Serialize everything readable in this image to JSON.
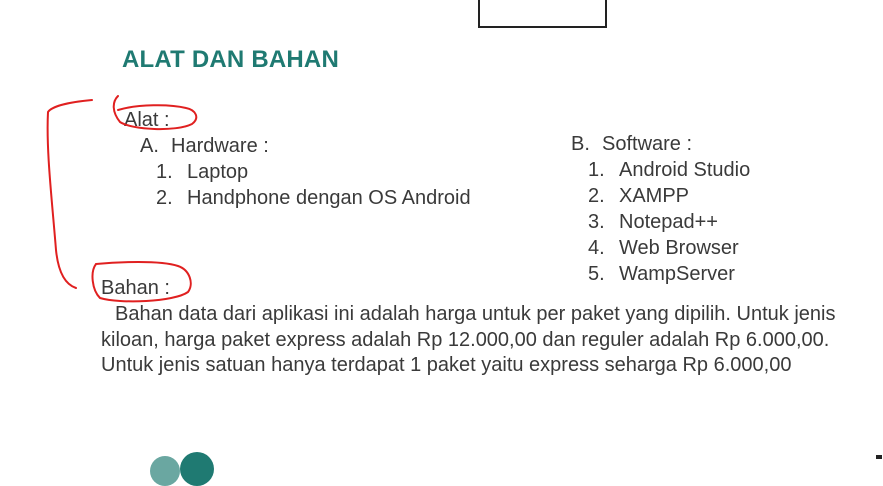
{
  "heading": "ALAT DAN BAHAN",
  "alat": {
    "label": "Alat :",
    "hardware": {
      "marker": "A.",
      "label": "Hardware :",
      "items": [
        {
          "num": "1.",
          "text": "Laptop"
        },
        {
          "num": "2.",
          "text": "Handphone dengan OS Android"
        }
      ]
    },
    "software": {
      "marker": "B.",
      "label": "Software :",
      "items": [
        {
          "num": "1.",
          "text": "Android Studio"
        },
        {
          "num": "2.",
          "text": "XAMPP"
        },
        {
          "num": "3.",
          "text": "Notepad++"
        },
        {
          "num": "4.",
          "text": "Web Browser"
        },
        {
          "num": "5.",
          "text": "WampServer"
        }
      ]
    }
  },
  "bahan": {
    "label": "Bahan :",
    "paragraph": "Bahan data dari aplikasi ini adalah harga untuk per paket yang dipilih. Untuk jenis kiloan, harga paket express adalah Rp 12.000,00 dan reguler adalah Rp 6.000,00. Untuk jenis satuan hanya terdapat 1 paket yaitu express seharga Rp 6.000,00"
  },
  "colors": {
    "heading": "#1f7a72",
    "annotation": "#e02020",
    "text": "#3a3a3a"
  }
}
